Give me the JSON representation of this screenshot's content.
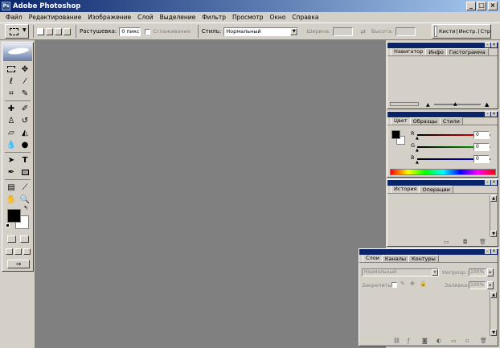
{
  "app": {
    "title": "Adobe Photoshop",
    "logo_text": "Ps"
  },
  "window_controls": {
    "minimize": "_",
    "maximize": "□",
    "close": "×"
  },
  "menu": [
    "Файл",
    "Редактирование",
    "Изображение",
    "Слой",
    "Выделение",
    "Фильтр",
    "Просмотр",
    "Окно",
    "Справка"
  ],
  "options": {
    "feather_label": "Растушевка:",
    "feather_value": "0 пикс",
    "antialias_label": "Сглаживание",
    "style_label": "Стиль:",
    "style_value": "Нормальный",
    "width_label": "Ширина:",
    "height_label": "Высота:",
    "palette_well_label": "Кисти",
    "palette_well_label2": "Инстр.",
    "palette_well_label3": "Стр"
  },
  "navigator": {
    "tabs": [
      "Навигатор",
      "Инфо",
      "Гистограмма"
    ]
  },
  "color": {
    "tabs": [
      "Цвет",
      "Образцы",
      "Стили"
    ],
    "channels": [
      {
        "label": "R",
        "value": "0",
        "color": "#c00000"
      },
      {
        "label": "G",
        "value": "0",
        "color": "#00a000"
      },
      {
        "label": "B",
        "value": "0",
        "color": "#0000c0"
      }
    ]
  },
  "history": {
    "tabs": [
      "История",
      "Операции"
    ]
  },
  "layers": {
    "tabs": [
      "Слои",
      "Каналы",
      "Контуры"
    ],
    "blend_mode": "Нормальный",
    "opacity_label": "Непрозр.:",
    "opacity_value": "100%",
    "lock_label": "Закрепить:",
    "fill_label": "Заливка:",
    "fill_value": "100%"
  },
  "colors": {
    "title_bar": "#0a246a",
    "workspace": "#808080",
    "chrome": "#d4d0c8"
  }
}
